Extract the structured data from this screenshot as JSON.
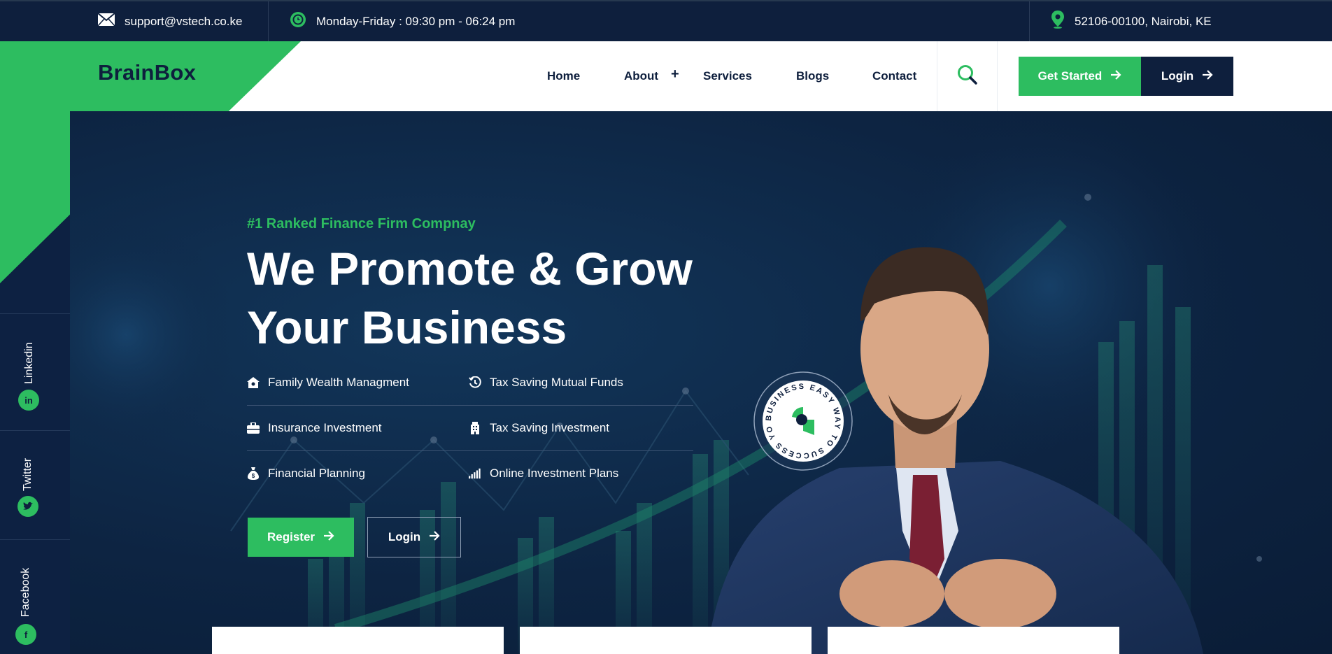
{
  "topbar": {
    "email": "support@vstech.co.ke",
    "hours": "Monday-Friday : 09:30 pm - 06:24 pm",
    "address": "52106-00100, Nairobi, KE"
  },
  "header": {
    "logo": "BrainBox",
    "nav": {
      "home": "Home",
      "about": "About",
      "about_toggle": "+",
      "services": "Services",
      "blogs": "Blogs",
      "contact": "Contact"
    },
    "get_started": "Get Started",
    "login": "Login"
  },
  "social": {
    "linkedin": "Linkedin",
    "twitter": "Twitter",
    "facebook": "Facebook"
  },
  "hero": {
    "tagline": "#1 Ranked Finance Firm Compnay",
    "headline_line1": "We Promote & Grow",
    "headline_line2": "Your Business",
    "features": [
      "Family Wealth Managment",
      "Tax Saving Mutual Funds",
      "Insurance Investment",
      "Tax Saving Investment",
      "Financial Planning",
      "Online Investment Plans"
    ],
    "register": "Register",
    "login": "Login",
    "badge_text": "BUSINESS EASY WAY TO SUCCESS YOUR "
  },
  "colors": {
    "accent": "#2dbd60",
    "navy": "#0e1f3d",
    "hero_bg": "#0d2442"
  }
}
